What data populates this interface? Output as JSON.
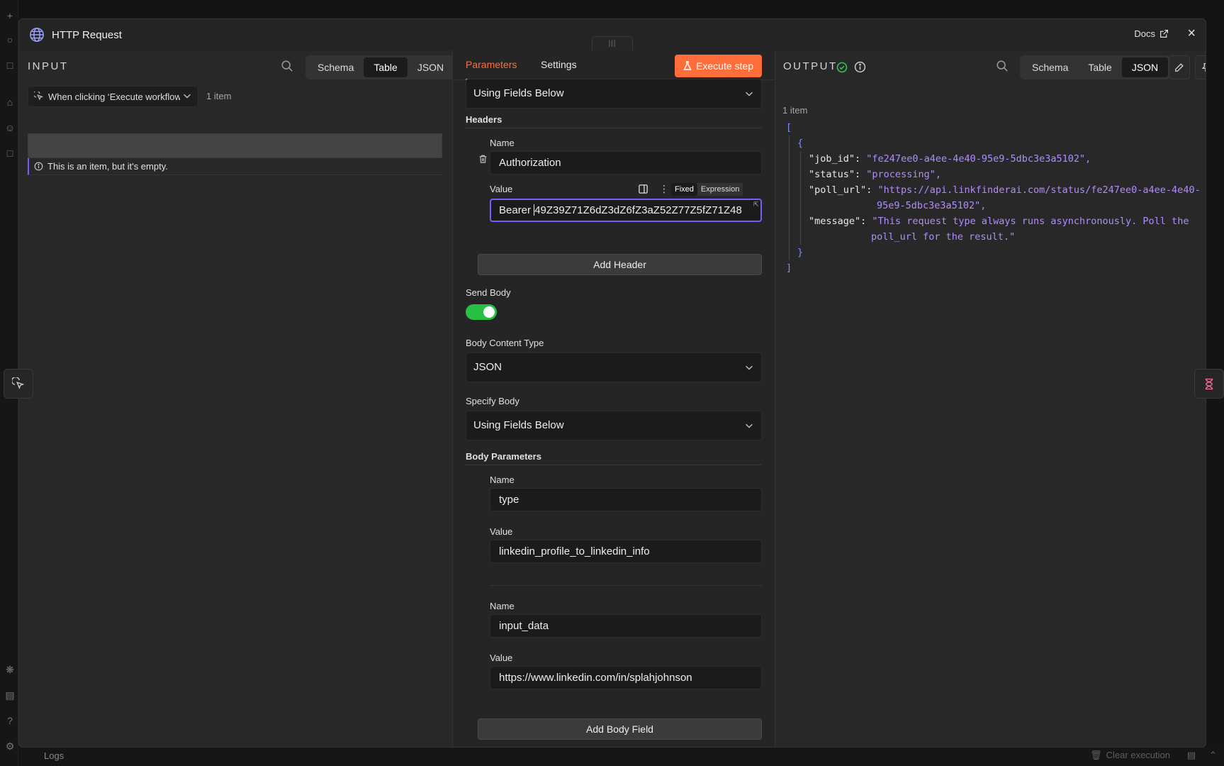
{
  "modal": {
    "title": "HTTP Request",
    "docs_label": "Docs"
  },
  "background": {
    "logs_label": "Logs",
    "clear_execution_label": "Clear execution"
  },
  "input_pane": {
    "label": "INPUT",
    "view_tabs": [
      "Schema",
      "Table",
      "JSON"
    ],
    "active_view": "Table",
    "trigger_select": "When clicking ‘Execute workflow’",
    "item_count": "1 item",
    "empty_message": "This is an item, but it's empty."
  },
  "params_pane": {
    "tabs": [
      "Parameters",
      "Settings"
    ],
    "active_tab": "Parameters",
    "execute_label": "Execute step",
    "specify_headers_value": "Using Fields Below",
    "headers_label": "Headers",
    "header": {
      "name_label": "Name",
      "name_value": "Authorization",
      "value_label": "Value",
      "value_prefix": "Bearer ",
      "value_rest": "49Z39Z71Z6dZ3dZ6fZ3aZ52Z77Z5fZ71Z48",
      "mode_fixed": "Fixed",
      "mode_expression": "Expression",
      "active_mode": "Fixed"
    },
    "add_header_label": "Add Header",
    "send_body_label": "Send Body",
    "send_body_on": true,
    "body_content_type_label": "Body Content Type",
    "body_content_type_value": "JSON",
    "specify_body_label": "Specify Body",
    "specify_body_value": "Using Fields Below",
    "body_parameters_label": "Body Parameters",
    "body_params": [
      {
        "name_label": "Name",
        "name_value": "type",
        "value_label": "Value",
        "value_value": "linkedin_profile_to_linkedin_info"
      },
      {
        "name_label": "Name",
        "name_value": "input_data",
        "value_label": "Value",
        "value_value": "https://www.linkedin.com/in/splahjohnson"
      }
    ],
    "add_body_field_label": "Add Body Field"
  },
  "output_pane": {
    "label": "OUTPUT",
    "view_tabs": [
      "Schema",
      "Table",
      "JSON"
    ],
    "active_view": "JSON",
    "item_count": "1 item",
    "json": {
      "job_id_key": "\"job_id\":",
      "job_id_val": "\"fe247ee0-a4ee-4e40-95e9-5dbc3e3a5102\",",
      "status_key": "\"status\":",
      "status_val": "\"processing\",",
      "poll_url_key": "\"poll_url\":",
      "poll_url_val_1": "\"https://api.linkfinderai.com/status/fe247ee0-a4ee-4e40-",
      "poll_url_val_2": "95e9-5dbc3e3a5102\",",
      "message_key": "\"message\":",
      "message_val_1": "\"This request type always runs asynchronously. Poll the",
      "message_val_2": "poll_url for the result.\""
    }
  },
  "colors": {
    "accent": "#ff6d3a",
    "focus": "#7c5cff",
    "success": "#26c043",
    "json_string": "#b08cff"
  }
}
